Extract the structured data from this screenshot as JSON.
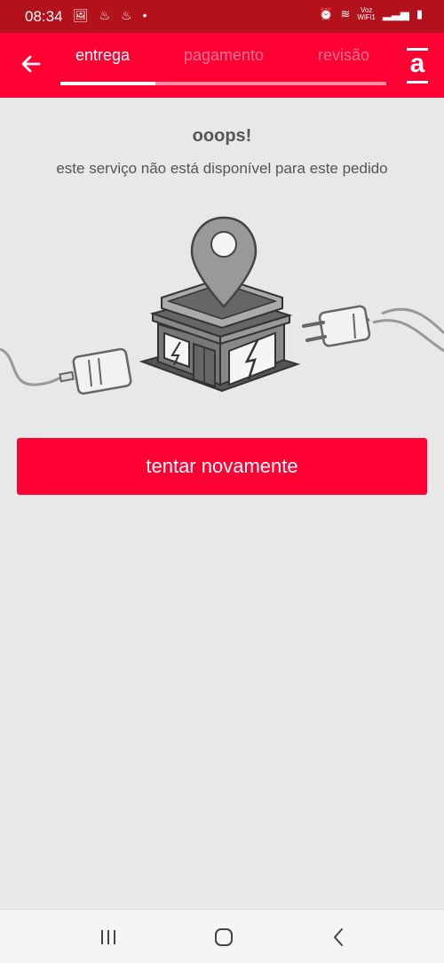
{
  "status_bar": {
    "time": "08:34",
    "left_icons": [
      "image-icon",
      "flame-icon",
      "flame-icon",
      "dot-icon"
    ],
    "voz_label": "Voz",
    "wifi_label": "WiFi1"
  },
  "header": {
    "tabs": [
      {
        "label": "entrega",
        "active": true
      },
      {
        "label": "pagamento",
        "active": false
      },
      {
        "label": "revisão",
        "active": false
      }
    ],
    "logo_letter": "a"
  },
  "content": {
    "title": "ooops!",
    "message": "este serviço não está disponível para este pedido",
    "retry_label": "tentar novamente"
  },
  "colors": {
    "status_bar": "#b3111b",
    "brand": "#ff0033",
    "background": "#e8e8e8"
  }
}
